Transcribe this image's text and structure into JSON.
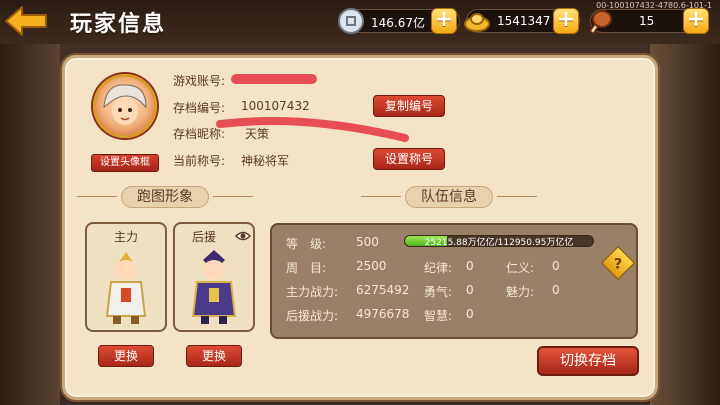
{
  "header": {
    "title": "玩家信息",
    "debug_id": "00-100107432-4780.6-101-1"
  },
  "resources": [
    {
      "icon": "silver-coin-icon",
      "value": "146.67亿"
    },
    {
      "icon": "gold-ingot-icon",
      "value": "1541347"
    },
    {
      "icon": "drumstick-icon",
      "value": "15"
    }
  ],
  "profile": {
    "set_avatar_frame": "设置头像框",
    "account_label": "游戏账号:",
    "save_id_label": "存档编号:",
    "save_id_value": "100107432",
    "nickname_label": "存档昵称:",
    "nickname_value": "天策",
    "title_label": "当前称号:",
    "title_value": "神秘将军",
    "copy_id_button": "复制编号",
    "set_title_button": "设置称号"
  },
  "run_image": {
    "section_title": "跑图形象",
    "main_label": "主力",
    "support_label": "后援",
    "swap_label": "更换"
  },
  "team": {
    "section_title": "队伍信息",
    "level_label": "等　级:",
    "level_value": "500",
    "xp_text": "25215.88万亿亿/112950.95万亿亿",
    "xp_fraction": 0.223,
    "round_label": "周　目:",
    "round_value": "2500",
    "main_power_label": "主力战力:",
    "main_power_value": "6275492",
    "support_power_label": "后援战力:",
    "support_power_value": "4976678",
    "discipline_label": "纪律:",
    "discipline_value": "0",
    "benevolence_label": "仁义:",
    "benevolence_value": "0",
    "courage_label": "勇气:",
    "courage_value": "0",
    "charm_label": "魅力:",
    "charm_value": "0",
    "wisdom_label": "智慧:",
    "wisdom_value": "0",
    "help": "?"
  },
  "switch_save_button": "切换存档",
  "colors": {
    "panel": "#f4e3c5",
    "button_red": "#c33424",
    "xp_green": "#6fcf2a",
    "plus_gold": "#f5a915"
  }
}
